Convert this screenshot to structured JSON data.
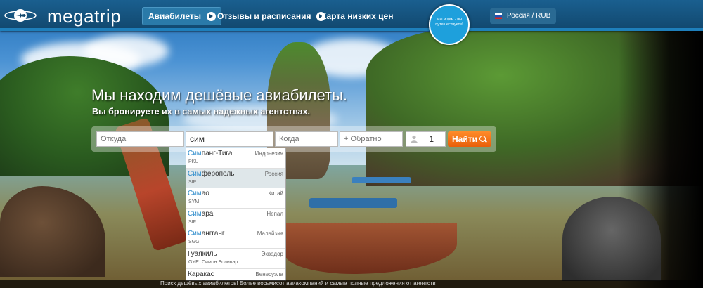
{
  "header": {
    "logo_text": "megatrip",
    "nav": [
      {
        "label": "Авиабилеты",
        "active": true
      },
      {
        "label": "Отзывы и расписания",
        "active": false
      },
      {
        "label": "Карта низких цен",
        "active": false
      }
    ],
    "promo": "Мы ищем - вы путешествуете!",
    "region": "Россия / RUB"
  },
  "hero": {
    "title": "Мы находим дешёвые авиабилеты.",
    "subtitle": "Вы бронируете их в самых надежных агентствах."
  },
  "search": {
    "from_placeholder": "Откуда",
    "to_value": "сим",
    "date_placeholder": "Когда",
    "return_placeholder": "+ Обратно",
    "passengers": "1",
    "find_label": "Найти"
  },
  "suggestions": [
    {
      "match": "Сим",
      "rest": "панг-Тига",
      "country": "Индонезия",
      "code": "PKU",
      "airport": "",
      "highlighted": false
    },
    {
      "match": "Сим",
      "rest": "ферополь",
      "country": "Россия",
      "code": "SIP",
      "airport": "",
      "highlighted": true
    },
    {
      "match": "Сим",
      "rest": "ао",
      "country": "Китай",
      "code": "SYM",
      "airport": "",
      "highlighted": false
    },
    {
      "match": "Сим",
      "rest": "ара",
      "country": "Непал",
      "code": "SIF",
      "airport": "",
      "highlighted": false
    },
    {
      "match": "Сим",
      "rest": "ангганг",
      "country": "Малайзия",
      "code": "SGG",
      "airport": "",
      "highlighted": false
    },
    {
      "match": "",
      "rest": "Гуаякиль",
      "country": "Эквадор",
      "code": "GYE",
      "airport": "Симон Боливар",
      "highlighted": false
    },
    {
      "match": "",
      "rest": "Каракас",
      "country": "Венесуэла",
      "code": "",
      "airport": "",
      "highlighted": false
    }
  ],
  "footer": {
    "text": "Поиск дешёвых авиабилетов! Более восьмисот авиакомпаний и самые полные предложения от агентств"
  },
  "colors": {
    "header_bg": "#11476d",
    "accent_blue": "#1ea0dc",
    "button_orange": "#ff7a1a",
    "match_blue": "#2f8dcc"
  }
}
